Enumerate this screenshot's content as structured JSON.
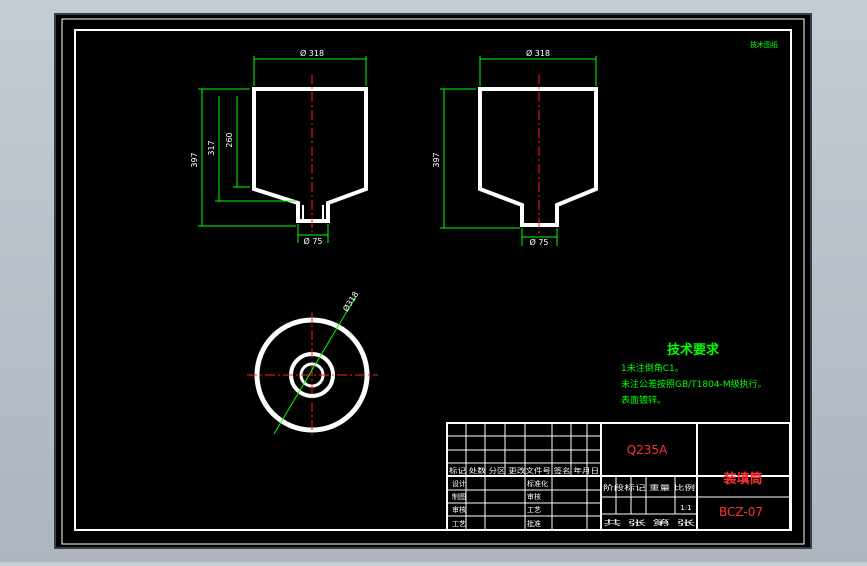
{
  "drawing": {
    "corner_note": "技术图纸",
    "views": {
      "left": {
        "top_diameter": "Ø 318",
        "bottom_diameter": "Ø 75",
        "overall_height": "397",
        "mid_height": "317",
        "inner_height": "260"
      },
      "right": {
        "top_diameter": "Ø 318",
        "bottom_diameter": "Ø 75",
        "overall_height": "397"
      },
      "plan": {
        "diameter": "Ø318"
      }
    },
    "tech_requirements": {
      "title": "技术要求",
      "lines": [
        "1未注倒角C1。",
        "未注公差按照GB/T1804-M级执行。",
        "表面镀锌。"
      ]
    },
    "title_block": {
      "material": "Q235A",
      "part_name": "装填筒",
      "drawing_number": "BCZ-07",
      "scale": "1:1",
      "header_row": "标记 处数 分区 更改文件号 签名 年月日",
      "rows": [
        {
          "label": "设计",
          "right_label": "标准化"
        },
        {
          "label": "制图",
          "right_label": "审核"
        },
        {
          "label": "审核",
          "right_label": "工艺"
        },
        {
          "label": "工艺",
          "right_label": "批准"
        }
      ],
      "stage_labels": "阶段标记  重量  比例",
      "sheet_info": "共  张  第  张"
    }
  },
  "colors": {
    "background": "#000000",
    "frame": "#ffffff",
    "dimension": "#00ff00",
    "centerline": "#ff2020",
    "text_requirements": "#00ff00",
    "title_red": "#ff3030",
    "title_block_text": "#ffffff"
  }
}
